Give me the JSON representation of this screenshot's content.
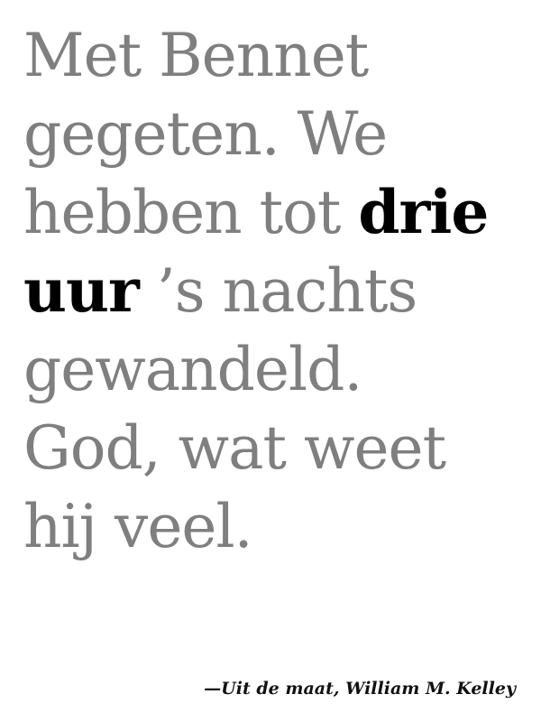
{
  "quote": {
    "lines": [
      {
        "text": "Met Bennet"
      },
      {
        "text": "gegeten. We"
      },
      {
        "before": "hebben tot ",
        "emphasis": "drie"
      },
      {
        "emphasis": "uur",
        "after": " ’s nachts"
      },
      {
        "text": "gewandeld."
      },
      {
        "text": "God, wat weet"
      },
      {
        "text": "hij veel."
      }
    ],
    "text_color": "#7f7f7f",
    "emphasis_color": "#000000"
  },
  "attribution": "—Uit de maat, William M. Kelley"
}
